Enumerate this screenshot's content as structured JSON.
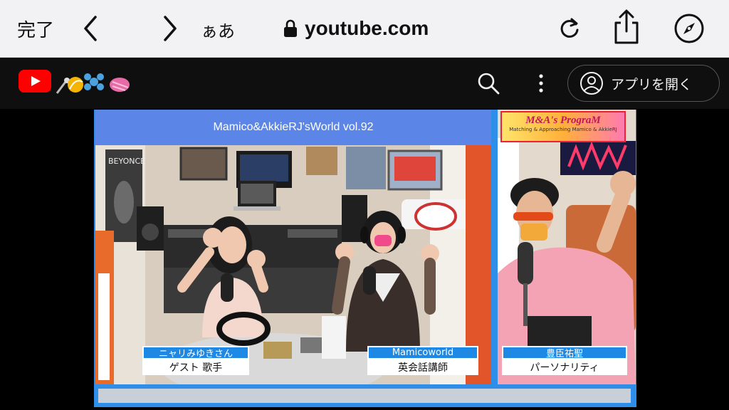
{
  "browser": {
    "done_label": "完了",
    "text_size_label": "ぁあ",
    "url": "youtube.com"
  },
  "youtube": {
    "open_app_label": "アプリを開く"
  },
  "video": {
    "show_title": "Mamico&AkkieRJ'sWorld vol.92",
    "program_banner": {
      "title": "M&A's PrograM",
      "subtitle": "Matching & Approaching  Mamico & AkkieRJ"
    },
    "guests": [
      {
        "name": "ニャリみゆきさん",
        "role": "ゲスト 歌手"
      },
      {
        "name": "Mamicoworld",
        "role": "英会話講師"
      },
      {
        "name": "豊臣祐聖",
        "role": "パーソナリティ"
      }
    ],
    "posters": {
      "beyonce": "BEYONCE"
    }
  },
  "colors": {
    "safari_bg": "#f2f2f4",
    "youtube_header_bg": "#0f0f0f",
    "youtube_red": "#ff0000",
    "video_frame_blue": "#2f8ee8",
    "name_tag_blue": "#1e88e5"
  }
}
